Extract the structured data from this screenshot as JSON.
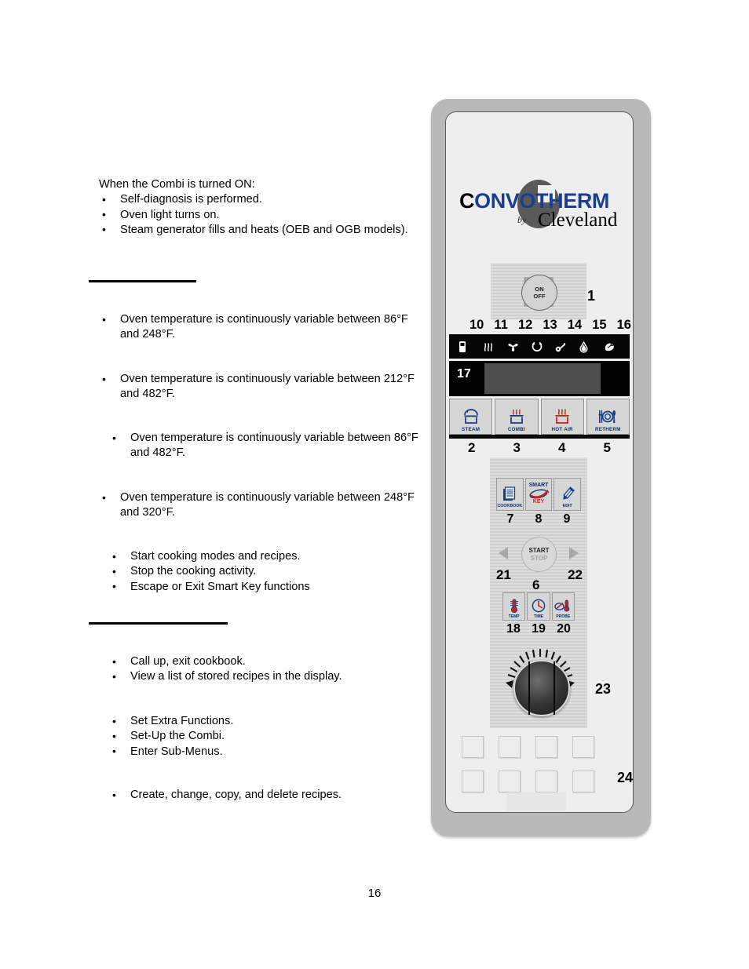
{
  "document": {
    "page_number": "16",
    "sections": [
      {
        "id": "power-on",
        "lead": "When the Combi is turned ON:",
        "bullets": [
          "Self-diagnosis is performed.",
          "Oven light turns on.",
          "Steam generator fills and heats (OEB and OGB models)."
        ]
      },
      {
        "id": "steam-mode",
        "bullets": [
          "Oven temperature is continuously variable between 86°F and 248°F."
        ]
      },
      {
        "id": "hot-air-mode",
        "bullets": [
          "Oven temperature is continuously variable between 212°F and 482°F."
        ]
      },
      {
        "id": "combi-mode",
        "bullets": [
          "Oven temperature is continuously variable between 86°F and 482°F."
        ]
      },
      {
        "id": "retherm-mode",
        "bullets": [
          "Oven temperature is continuously variable between 248°F and 320°F."
        ]
      },
      {
        "id": "start-stop",
        "bullets": [
          "Start cooking modes and recipes.",
          "Stop the cooking activity.",
          "Escape or Exit Smart Key functions"
        ]
      },
      {
        "id": "cookbook",
        "bullets": [
          "Call up, exit cookbook.",
          "View a list of stored recipes in the display."
        ]
      },
      {
        "id": "smart-key",
        "bullets": [
          "Set Extra Functions.",
          "Set-Up the Combi.",
          "Enter Sub-Menus."
        ]
      },
      {
        "id": "edit",
        "bullets": [
          "Create, change, copy, and delete recipes."
        ]
      }
    ]
  },
  "panel": {
    "logo": {
      "word_first": "C",
      "word_rest": "ONVOTHERM",
      "by": "by",
      "brand": "Cleveland"
    },
    "power": {
      "line1": "ON",
      "line2": "OFF",
      "callout": "1"
    },
    "status_icons": {
      "callouts": [
        "10",
        "11",
        "12",
        "13",
        "14",
        "15",
        "16"
      ],
      "names": [
        "core-probe-icon",
        "steam-waves-icon",
        "fan-icon",
        "circulation-icon",
        "key-icon",
        "water-drop-icon",
        "spray-clean-icon"
      ],
      "glyphs": [
        "▯",
        "≋",
        "✿",
        "↻",
        "⚿",
        "◇",
        "◕"
      ]
    },
    "display": {
      "callout": "17"
    },
    "mode_keys": [
      {
        "label": "STEAM",
        "callout": "2",
        "icon": "steam-pan-icon"
      },
      {
        "label": "COMBI",
        "callout": "3",
        "icon": "combi-pan-icon"
      },
      {
        "label": "HOT AIR",
        "callout": "4",
        "icon": "hot-air-icon"
      },
      {
        "label": "RETHERM",
        "callout": "5",
        "icon": "plate-cutlery-icon"
      }
    ],
    "function_keys": [
      {
        "label": "COOKBOOK",
        "callout": "7",
        "icon": "cookbook-icon"
      },
      {
        "label_top": "SMART",
        "label_bottom": "KEY",
        "callout": "8",
        "icon": "smart-key-icon"
      },
      {
        "label": "EDIT",
        "callout": "9",
        "icon": "pencil-icon"
      }
    ],
    "start_stop": {
      "line1": "START",
      "line2": "STOP",
      "callout": "6",
      "left_arrow_callout": "21",
      "right_arrow_callout": "22"
    },
    "value_keys": [
      {
        "label": "TEMP",
        "callout": "18",
        "icon": "thermometer-icon"
      },
      {
        "label": "TIME",
        "callout": "19",
        "icon": "clock-icon"
      },
      {
        "label": "PROBE",
        "callout": "20",
        "icon": "probe-icon"
      }
    ],
    "dial": {
      "callout": "23",
      "name": "rotary-dial"
    },
    "keypad": {
      "callout": "24",
      "name": "blank-key-grid",
      "rows": 2,
      "columns": 4
    }
  },
  "colors": {
    "brand_blue": "#1a3f91",
    "icon_blue": "#0d2a5e",
    "accent_red": "#c2261f",
    "bezel_gray": "#b9b9b9",
    "panel_face": "#eeeeee",
    "display_black": "#050505",
    "display_screen": "#4e4e4e"
  }
}
